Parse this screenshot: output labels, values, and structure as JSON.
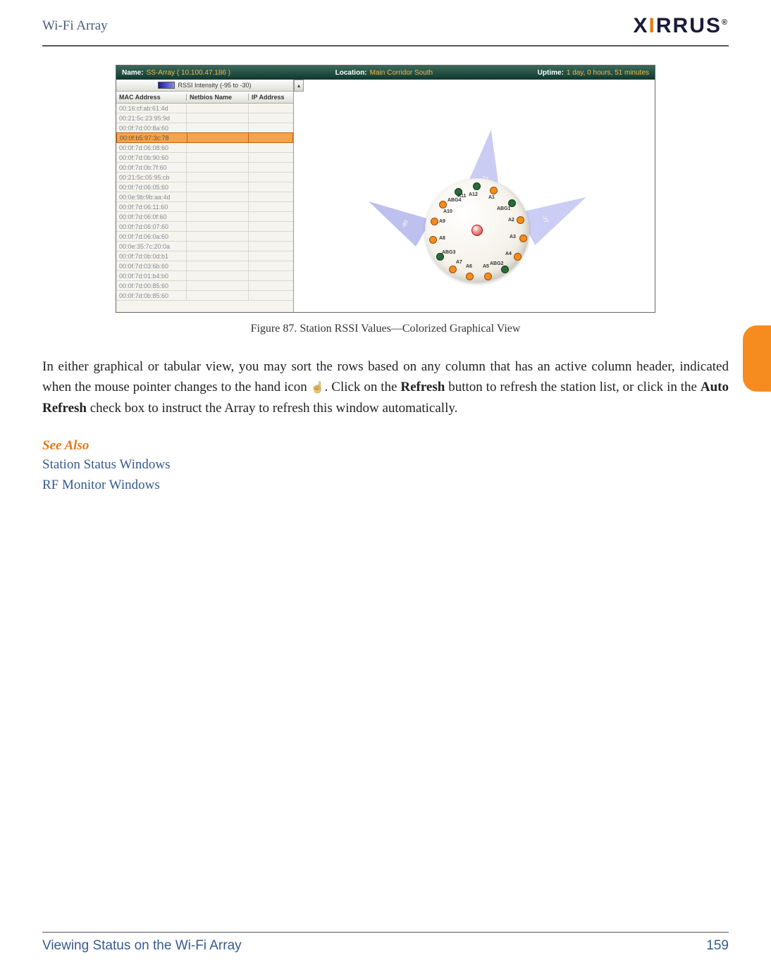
{
  "header": {
    "title": "Wi-Fi Array",
    "logo_text_pre": "X",
    "logo_text_post": "RRUS",
    "logo_i": "I",
    "logo_reg": "®"
  },
  "app": {
    "name_label": "Name:",
    "name_value": "SS-Array   ( 10.100.47.186 )",
    "location_label": "Location:",
    "location_value": "Main Corridor South",
    "uptime_label": "Uptime:",
    "uptime_value": "1 day, 0 hours, 51 minutes",
    "rssi_title": "RSSI Intensity (-95 to -30)",
    "columns": {
      "mac": "MAC Address",
      "netbios": "Netbios Name",
      "ip": "IP Address"
    },
    "selected_index": 3,
    "rows": [
      "00:16:cf:ab:61:4d",
      "00:21:5c:23:95:9d",
      "00:0f:7d:00:8a:60",
      "00:0f:b5:97:3c:78",
      "00:0f:7d:06:08:60",
      "00:0f:7d:0b:90:60",
      "00:0f:7d:0b:7f:60",
      "00:21:5c:05:95:cb",
      "00:0f:7d:06:05:60",
      "00:0e:9b:9b:aa:4d",
      "00:0f:7d:06:11:60",
      "00:0f:7d:06:0f:60",
      "00:0f:7d:06:07:60",
      "00:0f:7d:06:0a:60",
      "00:0e:35:7c:20:0a",
      "00:0f:7d:0b:0d:b1",
      "00:0f:7d:03:6b:60",
      "00:0f:7d:01:b4:b0",
      "00:0f:7d:00:85:60",
      "00:0f:7d:0b:85:60"
    ],
    "beam_labels": {
      "left": "-80",
      "top": "-77",
      "right": "-77"
    },
    "ap_labels": [
      "A1",
      "A2",
      "A3",
      "A4",
      "A5",
      "A6",
      "A7",
      "A8",
      "A9",
      "A10",
      "A11",
      "A12",
      "ABG1",
      "ABG2",
      "ABG3",
      "ABG4"
    ]
  },
  "figure_caption": "Figure 87. Station RSSI Values—Colorized Graphical View",
  "body": {
    "p1a": "In either graphical or tabular view, you may sort the rows based on any column that has an active column header, indicated when the mouse pointer changes to the hand icon ",
    "p1b": ". Click on the ",
    "p1_refresh": "Refresh",
    "p1c": " button to refresh the station list, or click in the ",
    "p1_auto": "Auto Refresh",
    "p1d": " check box to instruct the Array to refresh this window automatically."
  },
  "see_also": {
    "heading": "See Also",
    "links": [
      "Station Status Windows",
      "RF Monitor Windows"
    ]
  },
  "footer": {
    "section": "Viewing Status on the Wi-Fi Array",
    "page": "159"
  }
}
